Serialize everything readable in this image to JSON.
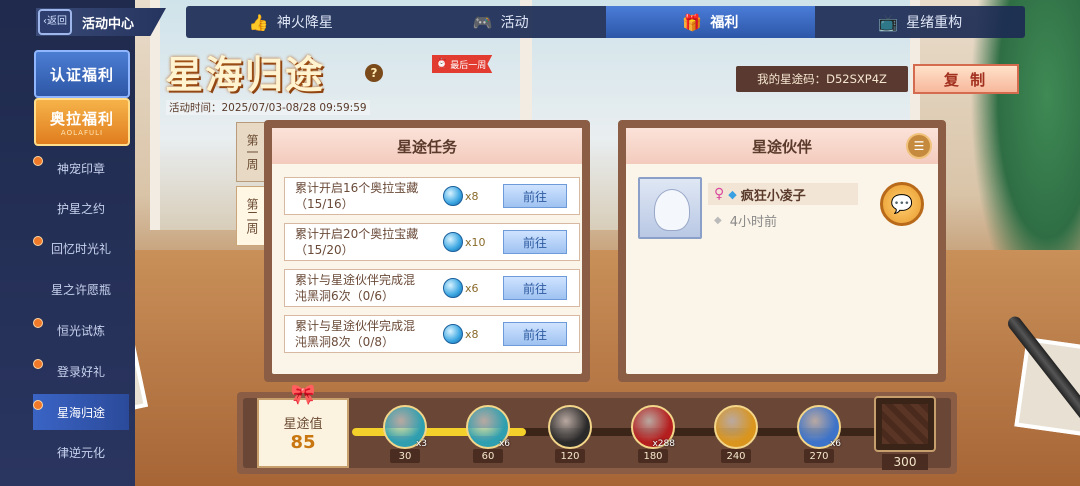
{
  "header": {
    "back_label": "返回",
    "center_title": "活动中心"
  },
  "sidebar": {
    "items": [
      {
        "label": "认证福利",
        "style": "big-blue"
      },
      {
        "label": "奥拉福利",
        "style": "big-orange",
        "sub": "AOLAFULI"
      },
      {
        "label": "神宠印章"
      },
      {
        "label": "护星之约"
      },
      {
        "label": "回忆时光礼"
      },
      {
        "label": "星之许愿瓶"
      },
      {
        "label": "恒光试炼"
      },
      {
        "label": "登录好礼"
      },
      {
        "label": "星海归途",
        "active": true
      },
      {
        "label": "律逆元化"
      }
    ]
  },
  "tabs": [
    {
      "label": "神火降星",
      "icon": "thumbs-up-icon"
    },
    {
      "label": "活动",
      "icon": "gamepad-icon"
    },
    {
      "label": "福利",
      "icon": "gift-icon",
      "selected": true
    },
    {
      "label": "星绪重构",
      "icon": "tv-icon"
    }
  ],
  "event": {
    "title": "星海归途",
    "badge": "最后一周",
    "time": "活动时间：2025/07/03-08/28 09:59:59",
    "code_label": "我的星途码：D52SXP4Z",
    "copy_label": "复 制"
  },
  "weeks": [
    {
      "label": "第一周"
    },
    {
      "label": "第二周",
      "selected": true
    }
  ],
  "tasks_panel": {
    "title": "星途任务",
    "go_label": "前往",
    "tasks": [
      {
        "line1": "累计开启16个奥拉宝藏",
        "line2": "（15/16）",
        "mult": "x8"
      },
      {
        "line1": "累计开启20个奥拉宝藏",
        "line2": "（15/20）",
        "mult": "x10"
      },
      {
        "line1": "累计与星途伙伴完成混",
        "line2": "沌黑洞6次（0/6）",
        "mult": "x6"
      },
      {
        "line1": "累计与星途伙伴完成混",
        "line2": "沌黑洞8次（0/8）",
        "mult": "x8"
      }
    ]
  },
  "partner_panel": {
    "title": "星途伙伴",
    "name": "疯狂小凌子",
    "last_seen": "4小时前"
  },
  "progress": {
    "label": "星途值",
    "value": "85",
    "fill_fraction": 0.3,
    "rewards": [
      {
        "threshold": "30",
        "qty": "x3",
        "color": "#2f9fb0"
      },
      {
        "threshold": "60",
        "qty": "x6",
        "color": "#2f9fb0"
      },
      {
        "threshold": "120",
        "qty": "",
        "color": "#2b2a2a"
      },
      {
        "threshold": "180",
        "qty": "x288",
        "color": "#b51e1e"
      },
      {
        "threshold": "240",
        "qty": "",
        "color": "#d9951e"
      },
      {
        "threshold": "270",
        "qty": "x6",
        "color": "#3d73c9"
      },
      {
        "threshold": "300",
        "qty": "",
        "color": "#3a2418"
      }
    ]
  }
}
